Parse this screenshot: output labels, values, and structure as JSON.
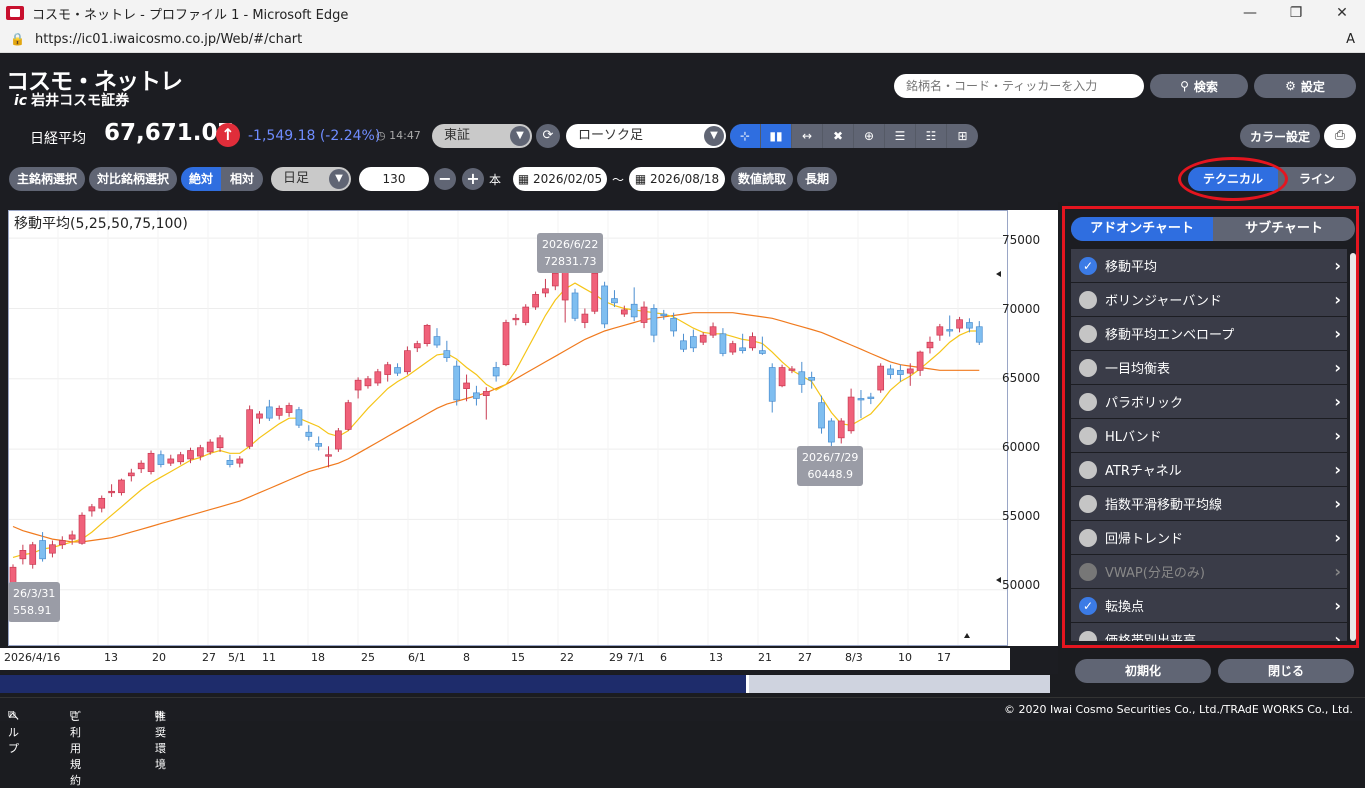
{
  "browser": {
    "title": "コスモ・ネットレ - プロファイル 1 - Microsoft Edge",
    "url": "https://ic01.iwaicosmo.co.jp/Web/#/chart"
  },
  "header": {
    "brand_top": "コスモ・ネットレ",
    "brand_bottom": "岩井コスモ証券",
    "brand_mark": "ic",
    "search_placeholder": "銘柄名・コード・ティッカーを入力",
    "search_label": "検索",
    "settings_label": "設定"
  },
  "quote": {
    "name": "日経平均",
    "price": "67,671.07",
    "change": "-1,549.18 (-2.24%)",
    "time": "14:47",
    "market": "東証",
    "chart_type": "ローソク足",
    "color_settings_label": "カラー設定"
  },
  "controls": {
    "main_symbol_label": "主銘柄選択",
    "compare_symbol_label": "対比銘柄選択",
    "absolute_label": "絶対",
    "relative_label": "相対",
    "period": "日足",
    "count": "130",
    "count_unit": "本",
    "date_from": "2026/02/05",
    "tilde": "〜",
    "date_to": "2026/08/18",
    "read_values_label": "数値読取",
    "long_term_label": "長期",
    "technical_label": "テクニカル",
    "line_label": "ライン"
  },
  "chart_data": {
    "type": "candlestick",
    "title": "移動平均(5,25,50,75,100)",
    "y_ticks": [
      "75000",
      "70000",
      "65000",
      "60000",
      "55000",
      "50000"
    ],
    "ylim": [
      46000,
      77000
    ],
    "x_ticks": [
      "2026/4/16",
      "13",
      "20",
      "27",
      "5/1",
      "11",
      "18",
      "25",
      "6/1",
      "8",
      "15",
      "22",
      "29",
      "7/1",
      "6",
      "13",
      "21",
      "27",
      "8/3",
      "10",
      "17"
    ],
    "annotations": [
      {
        "date": "2026/6/22",
        "value": "72831.73"
      },
      {
        "date": "2026/7/29",
        "value": "60448.9"
      },
      {
        "date": "26/3/31",
        "value": "558.91"
      }
    ],
    "candles": [
      {
        "o": 50500,
        "h": 51800,
        "l": 50200,
        "c": 51600
      },
      {
        "o": 52200,
        "h": 53200,
        "l": 51800,
        "c": 52800
      },
      {
        "o": 51800,
        "h": 53400,
        "l": 51500,
        "c": 53200
      },
      {
        "o": 53500,
        "h": 54100,
        "l": 52000,
        "c": 52200
      },
      {
        "o": 52600,
        "h": 53500,
        "l": 52300,
        "c": 53200
      },
      {
        "o": 53200,
        "h": 53800,
        "l": 52900,
        "c": 53500
      },
      {
        "o": 53600,
        "h": 54200,
        "l": 53200,
        "c": 53900
      },
      {
        "o": 53300,
        "h": 55500,
        "l": 53200,
        "c": 55300
      },
      {
        "o": 55600,
        "h": 56100,
        "l": 55200,
        "c": 55900
      },
      {
        "o": 55800,
        "h": 56700,
        "l": 55500,
        "c": 56500
      },
      {
        "o": 56900,
        "h": 57500,
        "l": 56600,
        "c": 57000
      },
      {
        "o": 56900,
        "h": 57900,
        "l": 56700,
        "c": 57800
      },
      {
        "o": 58100,
        "h": 58600,
        "l": 57700,
        "c": 58300
      },
      {
        "o": 58600,
        "h": 59200,
        "l": 58300,
        "c": 59000
      },
      {
        "o": 58400,
        "h": 59900,
        "l": 58200,
        "c": 59700
      },
      {
        "o": 59600,
        "h": 59900,
        "l": 58700,
        "c": 58900
      },
      {
        "o": 59000,
        "h": 59600,
        "l": 58800,
        "c": 59300
      },
      {
        "o": 59100,
        "h": 59800,
        "l": 58900,
        "c": 59600
      },
      {
        "o": 59300,
        "h": 60100,
        "l": 59000,
        "c": 59900
      },
      {
        "o": 59500,
        "h": 60300,
        "l": 59200,
        "c": 60100
      },
      {
        "o": 59800,
        "h": 60700,
        "l": 59600,
        "c": 60500
      },
      {
        "o": 60100,
        "h": 61000,
        "l": 59800,
        "c": 60800
      },
      {
        "o": 59200,
        "h": 59600,
        "l": 58700,
        "c": 58900
      },
      {
        "o": 59000,
        "h": 59500,
        "l": 58700,
        "c": 59300
      },
      {
        "o": 60200,
        "h": 63100,
        "l": 60000,
        "c": 62800
      },
      {
        "o": 62200,
        "h": 62700,
        "l": 61800,
        "c": 62500
      },
      {
        "o": 63000,
        "h": 63500,
        "l": 62000,
        "c": 62200
      },
      {
        "o": 62400,
        "h": 63100,
        "l": 62100,
        "c": 62900
      },
      {
        "o": 62600,
        "h": 63300,
        "l": 62300,
        "c": 63100
      },
      {
        "o": 62800,
        "h": 63000,
        "l": 61500,
        "c": 61700
      },
      {
        "o": 61200,
        "h": 61700,
        "l": 60600,
        "c": 60900
      },
      {
        "o": 60400,
        "h": 60900,
        "l": 59900,
        "c": 60200
      },
      {
        "o": 59500,
        "h": 60200,
        "l": 58700,
        "c": 59600
      },
      {
        "o": 60000,
        "h": 61500,
        "l": 59800,
        "c": 61300
      },
      {
        "o": 61400,
        "h": 63500,
        "l": 61300,
        "c": 63300
      },
      {
        "o": 64200,
        "h": 65100,
        "l": 63600,
        "c": 64900
      },
      {
        "o": 64500,
        "h": 65200,
        "l": 64300,
        "c": 65000
      },
      {
        "o": 64700,
        "h": 65700,
        "l": 64500,
        "c": 65500
      },
      {
        "o": 65300,
        "h": 66200,
        "l": 64800,
        "c": 66000
      },
      {
        "o": 65800,
        "h": 66100,
        "l": 65200,
        "c": 65400
      },
      {
        "o": 65500,
        "h": 67300,
        "l": 65300,
        "c": 67000
      },
      {
        "o": 67200,
        "h": 67700,
        "l": 66900,
        "c": 67500
      },
      {
        "o": 67500,
        "h": 68900,
        "l": 67300,
        "c": 68800
      },
      {
        "o": 68000,
        "h": 68600,
        "l": 67200,
        "c": 67400
      },
      {
        "o": 67000,
        "h": 67700,
        "l": 66200,
        "c": 66500
      },
      {
        "o": 65900,
        "h": 66300,
        "l": 63100,
        "c": 63500
      },
      {
        "o": 64300,
        "h": 65300,
        "l": 63400,
        "c": 64700
      },
      {
        "o": 64000,
        "h": 64500,
        "l": 63100,
        "c": 63600
      },
      {
        "o": 63800,
        "h": 64400,
        "l": 62100,
        "c": 64100
      },
      {
        "o": 65800,
        "h": 66200,
        "l": 64800,
        "c": 65200
      },
      {
        "o": 66000,
        "h": 69200,
        "l": 65900,
        "c": 69000
      },
      {
        "o": 69200,
        "h": 69600,
        "l": 68800,
        "c": 69300
      },
      {
        "o": 69000,
        "h": 70300,
        "l": 68800,
        "c": 70100
      },
      {
        "o": 70100,
        "h": 71200,
        "l": 69900,
        "c": 71000
      },
      {
        "o": 71100,
        "h": 72100,
        "l": 70800,
        "c": 71400
      },
      {
        "o": 71600,
        "h": 72700,
        "l": 71300,
        "c": 72500
      },
      {
        "o": 70600,
        "h": 72700,
        "l": 69000,
        "c": 72600
      },
      {
        "o": 71100,
        "h": 71400,
        "l": 69100,
        "c": 69300
      },
      {
        "o": 69000,
        "h": 70000,
        "l": 68600,
        "c": 69600
      },
      {
        "o": 69800,
        "h": 72700,
        "l": 69600,
        "c": 72500
      },
      {
        "o": 71600,
        "h": 71900,
        "l": 68600,
        "c": 68900
      },
      {
        "o": 70700,
        "h": 71300,
        "l": 70100,
        "c": 70400
      },
      {
        "o": 69600,
        "h": 70200,
        "l": 69400,
        "c": 69900
      },
      {
        "o": 70300,
        "h": 71500,
        "l": 69100,
        "c": 69400
      },
      {
        "o": 69000,
        "h": 70500,
        "l": 68600,
        "c": 70100
      },
      {
        "o": 70000,
        "h": 70300,
        "l": 67600,
        "c": 68100
      },
      {
        "o": 69600,
        "h": 69900,
        "l": 69200,
        "c": 69500
      },
      {
        "o": 69300,
        "h": 69700,
        "l": 68000,
        "c": 68400
      },
      {
        "o": 67700,
        "h": 68200,
        "l": 66900,
        "c": 67100
      },
      {
        "o": 68000,
        "h": 68500,
        "l": 66900,
        "c": 67200
      },
      {
        "o": 67600,
        "h": 68300,
        "l": 67400,
        "c": 68100
      },
      {
        "o": 68100,
        "h": 69000,
        "l": 67900,
        "c": 68700
      },
      {
        "o": 68200,
        "h": 68600,
        "l": 66600,
        "c": 66800
      },
      {
        "o": 66900,
        "h": 67700,
        "l": 66700,
        "c": 67500
      },
      {
        "o": 67200,
        "h": 68200,
        "l": 66800,
        "c": 67000
      },
      {
        "o": 67200,
        "h": 68300,
        "l": 67000,
        "c": 68000
      },
      {
        "o": 67000,
        "h": 68000,
        "l": 66700,
        "c": 66800
      },
      {
        "o": 65800,
        "h": 66100,
        "l": 62600,
        "c": 63400
      },
      {
        "o": 64500,
        "h": 66000,
        "l": 64400,
        "c": 65800
      },
      {
        "o": 65600,
        "h": 65900,
        "l": 65400,
        "c": 65700
      },
      {
        "o": 65500,
        "h": 66200,
        "l": 64000,
        "c": 64600
      },
      {
        "o": 65100,
        "h": 65500,
        "l": 64300,
        "c": 64900
      },
      {
        "o": 63300,
        "h": 63800,
        "l": 61100,
        "c": 61500
      },
      {
        "o": 62000,
        "h": 62200,
        "l": 60100,
        "c": 60500
      },
      {
        "o": 60800,
        "h": 62200,
        "l": 60400,
        "c": 62000
      },
      {
        "o": 61300,
        "h": 64300,
        "l": 61100,
        "c": 63700
      },
      {
        "o": 63600,
        "h": 64200,
        "l": 62200,
        "c": 63500
      },
      {
        "o": 63700,
        "h": 64000,
        "l": 63200,
        "c": 63600
      },
      {
        "o": 64200,
        "h": 66100,
        "l": 64000,
        "c": 65900
      },
      {
        "o": 65700,
        "h": 66000,
        "l": 65000,
        "c": 65300
      },
      {
        "o": 65600,
        "h": 66000,
        "l": 64800,
        "c": 65300
      },
      {
        "o": 65400,
        "h": 66100,
        "l": 64500,
        "c": 65700
      },
      {
        "o": 65600,
        "h": 67000,
        "l": 65200,
        "c": 66900
      },
      {
        "o": 67200,
        "h": 68000,
        "l": 66800,
        "c": 67600
      },
      {
        "o": 68100,
        "h": 68900,
        "l": 67700,
        "c": 68700
      },
      {
        "o": 68500,
        "h": 69500,
        "l": 68000,
        "c": 68400
      },
      {
        "o": 68600,
        "h": 69400,
        "l": 68300,
        "c": 69200
      },
      {
        "o": 69000,
        "h": 69300,
        "l": 68300,
        "c": 68600
      },
      {
        "o": 68700,
        "h": 69100,
        "l": 67400,
        "c": 67600
      }
    ],
    "ma_short": [
      52300,
      52500,
      52600,
      52900,
      53000,
      53200,
      53400,
      53600,
      54100,
      54700,
      55300,
      55900,
      56500,
      57100,
      57600,
      58000,
      58400,
      58800,
      59200,
      59400,
      59700,
      59900,
      59700,
      59700,
      60200,
      60800,
      61300,
      61800,
      62200,
      62200,
      61900,
      61600,
      61100,
      60900,
      61300,
      62100,
      62900,
      63600,
      64300,
      64800,
      65200,
      65700,
      66200,
      66700,
      66800,
      66400,
      65800,
      65300,
      64600,
      64200,
      64600,
      65600,
      66900,
      68200,
      69500,
      70600,
      71400,
      71800,
      71400,
      71000,
      70500,
      70200,
      70000,
      69900,
      69800,
      69700,
      69600,
      69400,
      69000,
      68600,
      68300,
      68200,
      68200,
      68000,
      67800,
      67700,
      67500,
      66900,
      66200,
      65600,
      65200,
      64800,
      63700,
      62600,
      61800,
      61700,
      62100,
      62500,
      63300,
      64200,
      64800,
      65200,
      65700,
      66300,
      66900,
      67600,
      68100,
      68400,
      68400
    ]
  },
  "chart_ma_long": [
    54500,
    54200,
    54000,
    53800,
    53600,
    53500,
    53400,
    53400,
    53500,
    53600,
    53700,
    53900,
    54100,
    54300,
    54500,
    54700,
    54900,
    55100,
    55300,
    55500,
    55700,
    55900,
    56100,
    56300,
    56600,
    56900,
    57200,
    57500,
    57800,
    58100,
    58400,
    58600,
    58800,
    59000,
    59300,
    59700,
    60100,
    60500,
    60900,
    61300,
    61700,
    62100,
    62500,
    62900,
    63200,
    63400,
    63600,
    63800,
    64000,
    64300,
    64600,
    65000,
    65400,
    65800,
    66200,
    66600,
    67000,
    67400,
    67800,
    68100,
    68400,
    68600,
    68800,
    69000,
    69200,
    69300,
    69400,
    69500,
    69600,
    69700,
    69700,
    69700,
    69700,
    69700,
    69600,
    69500,
    69400,
    69300,
    69100,
    68900,
    68700,
    68500,
    68300,
    68000,
    67700,
    67400,
    67100,
    66800,
    66500,
    66200,
    66000,
    65900,
    65800,
    65700,
    65600,
    65600,
    65600,
    65600,
    65600
  ],
  "panel": {
    "tab_addon": "アドオンチャート",
    "tab_sub": "サブチャート",
    "items": [
      {
        "label": "移動平均",
        "checked": true,
        "enabled": true
      },
      {
        "label": "ボリンジャーバンド",
        "checked": false,
        "enabled": true
      },
      {
        "label": "移動平均エンベロープ",
        "checked": false,
        "enabled": true
      },
      {
        "label": "一目均衡表",
        "checked": false,
        "enabled": true
      },
      {
        "label": "パラボリック",
        "checked": false,
        "enabled": true
      },
      {
        "label": "HLバンド",
        "checked": false,
        "enabled": true
      },
      {
        "label": "ATRチャネル",
        "checked": false,
        "enabled": true
      },
      {
        "label": "指数平滑移動平均線",
        "checked": false,
        "enabled": true
      },
      {
        "label": "回帰トレンド",
        "checked": false,
        "enabled": true
      },
      {
        "label": "VWAP(分足のみ)",
        "checked": false,
        "enabled": false
      },
      {
        "label": "転換点",
        "checked": true,
        "enabled": true
      },
      {
        "label": "価格帯別出来高",
        "checked": false,
        "enabled": true
      }
    ],
    "reset_label": "初期化",
    "close_label": "閉じる"
  },
  "footer": {
    "help": "ヘルプ",
    "terms": "ご利用規約",
    "env": "推奨環境",
    "copyright": "© 2020 Iwai Cosmo Securities Co., Ltd./TRAdE WORKS Co., Ltd."
  },
  "colors": {
    "up": "#f0617a",
    "down": "#7fbef0",
    "ma_short": "#f5c518",
    "ma_long": "#f07a1e",
    "accent": "#2f6ee0"
  }
}
